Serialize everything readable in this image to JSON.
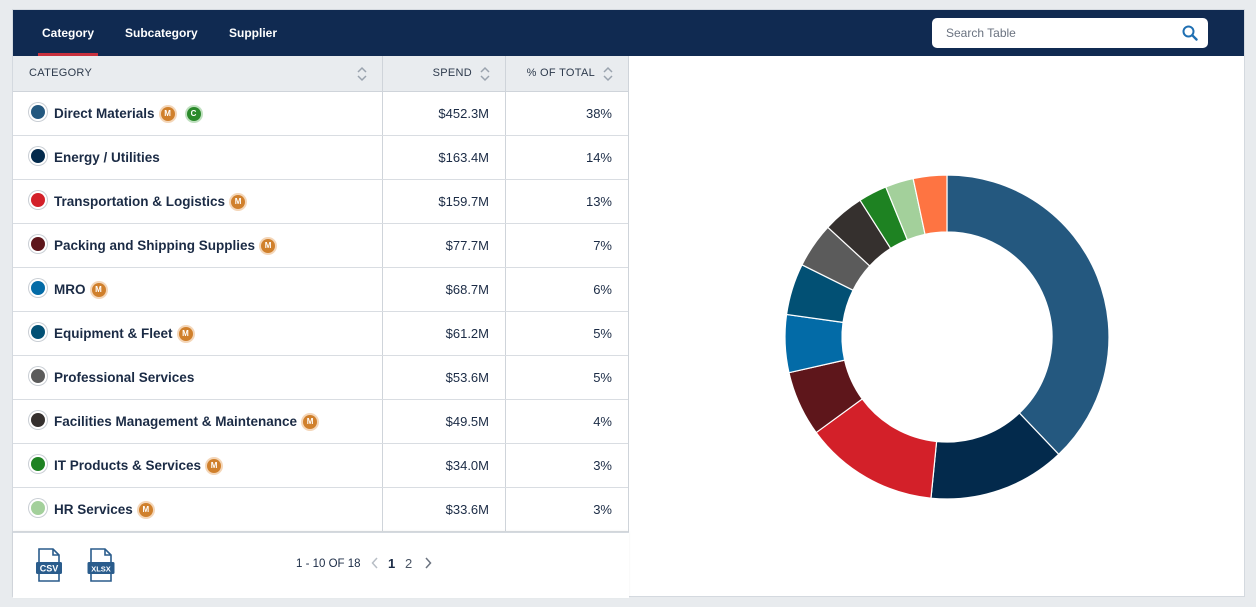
{
  "tabs": [
    {
      "label": "Category",
      "active": true
    },
    {
      "label": "Subcategory",
      "active": false
    },
    {
      "label": "Supplier",
      "active": false
    }
  ],
  "search": {
    "placeholder": "Search Table",
    "value": ""
  },
  "table": {
    "headers": {
      "category": "CATEGORY",
      "spend": "SPEND",
      "pct": "% OF TOTAL"
    },
    "rows": [
      {
        "label": "Direct Materials",
        "color": "#24587f",
        "spend": "$452.3M",
        "pct": "38%",
        "badges": [
          "M",
          "C"
        ]
      },
      {
        "label": "Energy / Utilities",
        "color": "#032a4c",
        "spend": "$163.4M",
        "pct": "14%",
        "badges": []
      },
      {
        "label": "Transportation & Logistics",
        "color": "#d32029",
        "spend": "$159.7M",
        "pct": "13%",
        "badges": [
          "M"
        ]
      },
      {
        "label": "Packing and Shipping Supplies",
        "color": "#5e161b",
        "spend": "$77.7M",
        "pct": "7%",
        "badges": [
          "M"
        ]
      },
      {
        "label": "MRO",
        "color": "#036ba7",
        "spend": "$68.7M",
        "pct": "6%",
        "badges": [
          "M"
        ]
      },
      {
        "label": "Equipment & Fleet",
        "color": "#025074",
        "spend": "$61.2M",
        "pct": "5%",
        "badges": [
          "M"
        ]
      },
      {
        "label": "Professional Services",
        "color": "#5b5b5b",
        "spend": "$53.6M",
        "pct": "5%",
        "badges": []
      },
      {
        "label": "Facilities Management & Maintenance",
        "color": "#35302e",
        "spend": "$49.5M",
        "pct": "4%",
        "badges": [
          "M"
        ]
      },
      {
        "label": "IT Products & Services",
        "color": "#1e8222",
        "spend": "$34.0M",
        "pct": "3%",
        "badges": [
          "M"
        ]
      },
      {
        "label": "HR Services",
        "color": "#a3d09b",
        "spend": "$33.6M",
        "pct": "3%",
        "badges": [
          "M"
        ]
      }
    ]
  },
  "footer": {
    "csv_label": "CSV",
    "xlsx_label": "XLSX",
    "page_range": "1 - 10 OF 18",
    "pages": [
      "1",
      "2"
    ],
    "current_page": "1"
  },
  "chart_data": {
    "type": "pie",
    "donut": true,
    "title": "",
    "legend": "none",
    "values": [
      452.3,
      163.4,
      159.7,
      77.7,
      68.7,
      61.2,
      53.6,
      49.5,
      34.0,
      33.6,
      40.0
    ],
    "colors": [
      "#24587f",
      "#032a4c",
      "#d32029",
      "#5e161b",
      "#036ba7",
      "#025074",
      "#5b5b5b",
      "#35302e",
      "#1e8222",
      "#a3d09b",
      "#fe7442"
    ]
  }
}
